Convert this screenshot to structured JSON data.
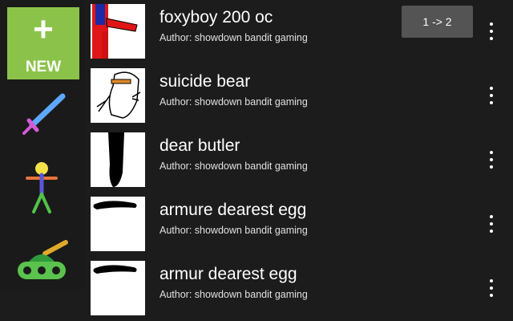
{
  "sidebar": {
    "new_button": {
      "icon": "plus-icon",
      "label": "NEW",
      "plus_glyph": "+",
      "color": "#8bc34a"
    },
    "tools": [
      {
        "icon": "sword-icon"
      },
      {
        "icon": "stick-figure-icon"
      },
      {
        "icon": "tank-icon"
      }
    ]
  },
  "animations": [
    {
      "title": "foxyboy 200 oc",
      "author": "Author: showdown bandit gaming",
      "badge": "1 -> 2"
    },
    {
      "title": "suicide bear",
      "author": "Author: showdown bandit gaming"
    },
    {
      "title": "dear butler",
      "author": "Author: showdown bandit gaming"
    },
    {
      "title": "armure dearest egg",
      "author": "Author: showdown bandit gaming"
    },
    {
      "title": "armur dearest egg",
      "author": "Author: showdown bandit gaming"
    }
  ],
  "colors": {
    "background": "#1c1c1c",
    "badge": "#545454",
    "text": "#ffffff"
  }
}
